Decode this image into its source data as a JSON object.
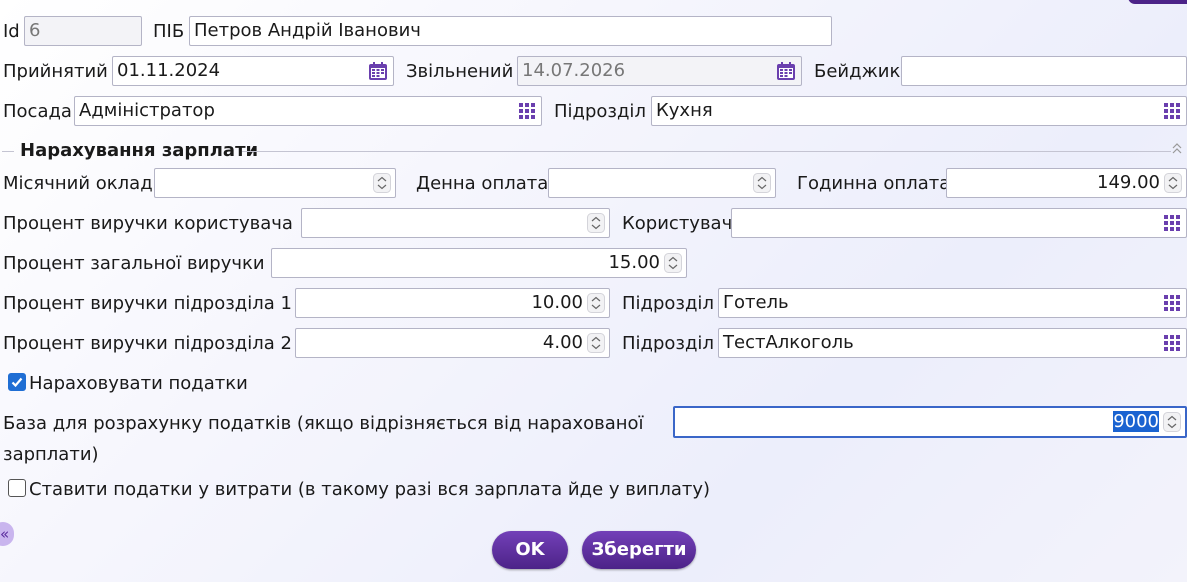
{
  "header": {
    "id_label": "Id",
    "id_value": "6",
    "name_label": "ПІБ",
    "name_value": "Петров Андрій Іванович",
    "hired_label": "Прийнятий",
    "hired_value": "01.11.2024",
    "fired_label": "Звільнений",
    "fired_value": "14.07.2026",
    "badge_label": "Бейджик",
    "badge_value": "",
    "position_label": "Посада",
    "position_value": "Адміністратор",
    "department_label": "Підрозділ",
    "department_value": "Кухня"
  },
  "salary": {
    "section_title": "Нарахування зарплати",
    "monthly_label": "Місячний оклад",
    "monthly_value": "",
    "daily_label": "Денна оплата",
    "daily_value": "",
    "hourly_label": "Годинна оплата",
    "hourly_value": "149.00",
    "user_rev_pct_label": "Процент виручки користувача",
    "user_rev_pct_value": "",
    "user_label": "Користувач",
    "user_value": "",
    "total_rev_pct_label": "Процент загальної виручки",
    "total_rev_pct_value": "15.00",
    "dept1_pct_label": "Процент виручки підрозділа 1",
    "dept1_pct_value": "10.00",
    "dept1_label": "Підрозділ",
    "dept1_value": "Готель",
    "dept2_pct_label": "Процент виручки підрозділа 2",
    "dept2_pct_value": "4.00",
    "dept2_label": "Підрозділ",
    "dept2_value": "ТестАлкоголь",
    "accrue_taxes_label": "Нараховувати податки",
    "tax_base_label_line1": "База для розрахунку податків (якщо відрізняється від нарахованої",
    "tax_base_label_line2": "зарплати)",
    "tax_base_value": "9000",
    "taxes_to_expenses_label": "Ставити податки у витрати (в такому разі вся зарплата йде у виплату)"
  },
  "footer": {
    "ok_label": "OK",
    "save_label": "Зберегти",
    "collapse_label": "«"
  },
  "colors": {
    "accent": "#5b2d9e",
    "icon": "#6a3fae",
    "check": "#1f6ed4"
  },
  "icons": {
    "picker": "grid-icon",
    "date": "calendar-icon",
    "spinner": "spinner-icon",
    "collapse": "chevron-up-icon"
  }
}
